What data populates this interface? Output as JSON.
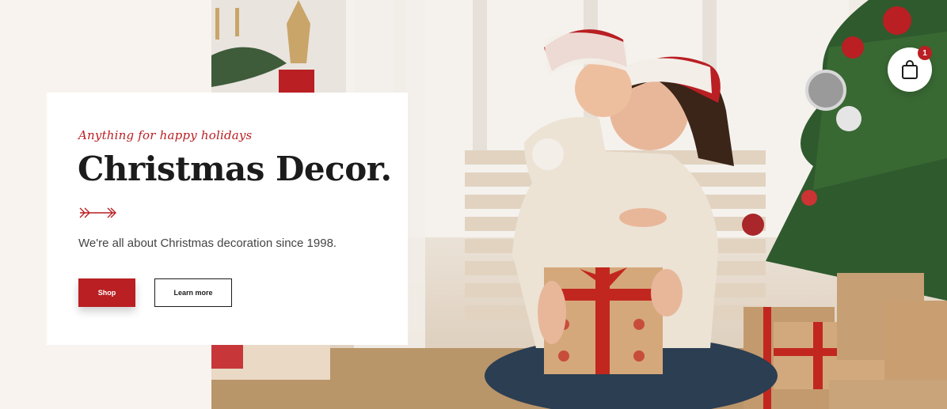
{
  "hero": {
    "tagline": "Anything for happy holidays",
    "title": "Christmas Decor.",
    "subtitle": "We're all about Christmas decoration since 1998.",
    "shop_label": "Shop",
    "learn_label": "Learn more"
  },
  "cart": {
    "count": "1",
    "icon": "shopping-bag-icon"
  },
  "colors": {
    "accent": "#b91f23",
    "dark": "#1c1c1c",
    "background": "#f8f3ee"
  }
}
